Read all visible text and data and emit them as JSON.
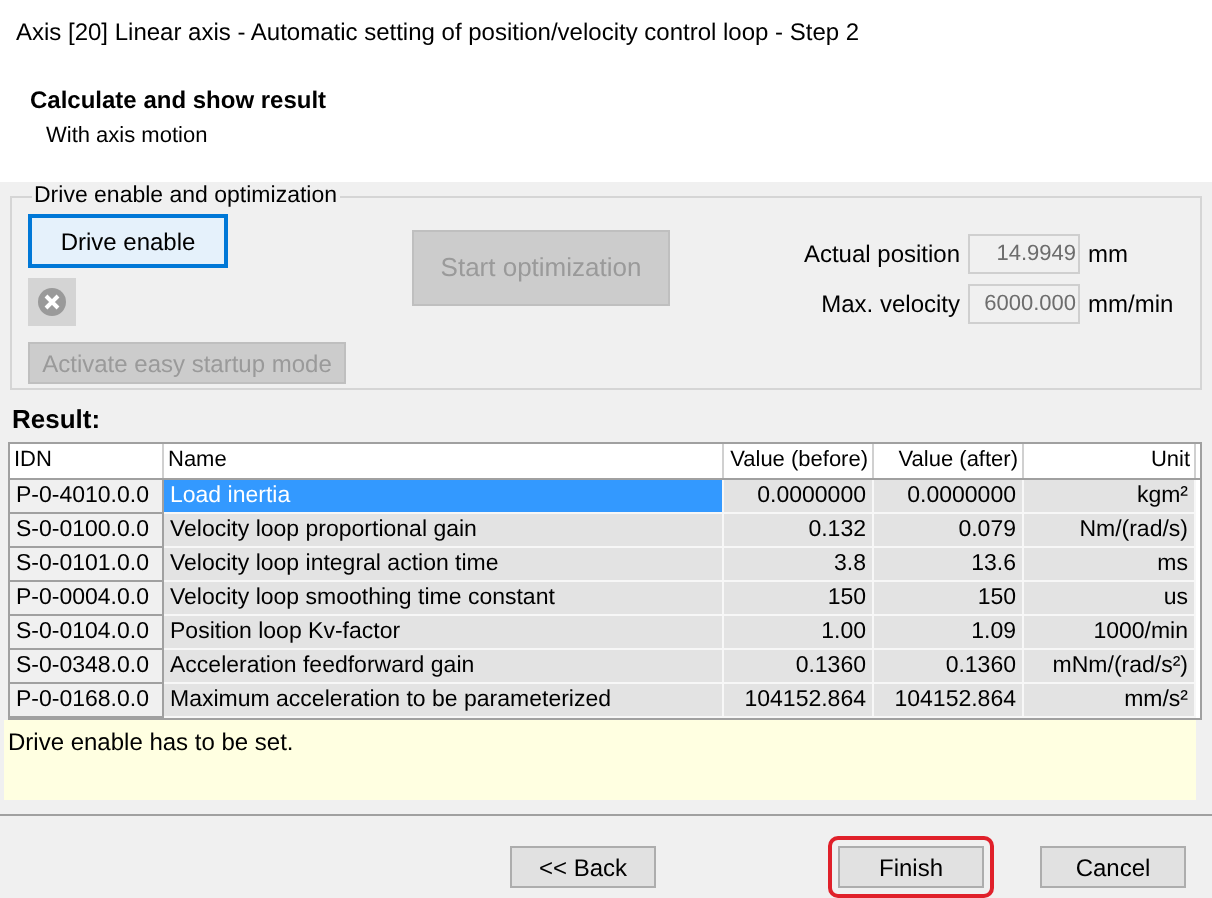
{
  "window": {
    "title": "Axis [20] Linear axis - Automatic setting of position/velocity control loop - Step 2"
  },
  "header": {
    "title": "Calculate and show result",
    "subtitle": "With axis motion"
  },
  "group": {
    "title": "Drive enable and optimization",
    "drive_enable": {
      "label": "Drive enable",
      "focused": true
    },
    "start_optimization": {
      "label": "Start optimization",
      "disabled": true
    },
    "easy_startup": {
      "label": "Activate easy startup mode",
      "disabled": true
    },
    "fields": [
      {
        "label": "Actual position",
        "value": "14.9949",
        "unit": "mm"
      },
      {
        "label": "Max. velocity",
        "value": "6000.000",
        "unit": "mm/min"
      }
    ]
  },
  "result": {
    "title": "Result:",
    "columns": [
      "IDN",
      "Name",
      "Value (before)",
      "Value (after)",
      "Unit"
    ],
    "rows": [
      {
        "idn": "P-0-4010.0.0",
        "name": "Load inertia",
        "before": "0.0000000",
        "after": "0.0000000",
        "unit": "kgm²",
        "selected": true
      },
      {
        "idn": "S-0-0100.0.0",
        "name": "Velocity loop proportional gain",
        "before": "0.132",
        "after": "0.079",
        "unit": "Nm/(rad/s)",
        "selected": false
      },
      {
        "idn": "S-0-0101.0.0",
        "name": "Velocity loop integral action time",
        "before": "3.8",
        "after": "13.6",
        "unit": "ms",
        "selected": false
      },
      {
        "idn": "P-0-0004.0.0",
        "name": "Velocity loop smoothing time constant",
        "before": "150",
        "after": "150",
        "unit": "us",
        "selected": false
      },
      {
        "idn": "S-0-0104.0.0",
        "name": "Position loop Kv-factor",
        "before": "1.00",
        "after": "1.09",
        "unit": "1000/min",
        "selected": false
      },
      {
        "idn": "S-0-0348.0.0",
        "name": "Acceleration feedforward gain",
        "before": "0.1360",
        "after": "0.1360",
        "unit": "mNm/(rad/s²)",
        "selected": false
      },
      {
        "idn": "P-0-0168.0.0",
        "name": "Maximum acceleration to be parameterized",
        "before": "104152.864",
        "after": "104152.864",
        "unit": "mm/s²",
        "selected": false
      }
    ]
  },
  "message": "Drive enable has to be set.",
  "buttons": [
    {
      "label": "<< Back",
      "highlighted": false
    },
    {
      "label": "Finish",
      "highlighted": true
    },
    {
      "label": "Cancel",
      "highlighted": false
    }
  ]
}
